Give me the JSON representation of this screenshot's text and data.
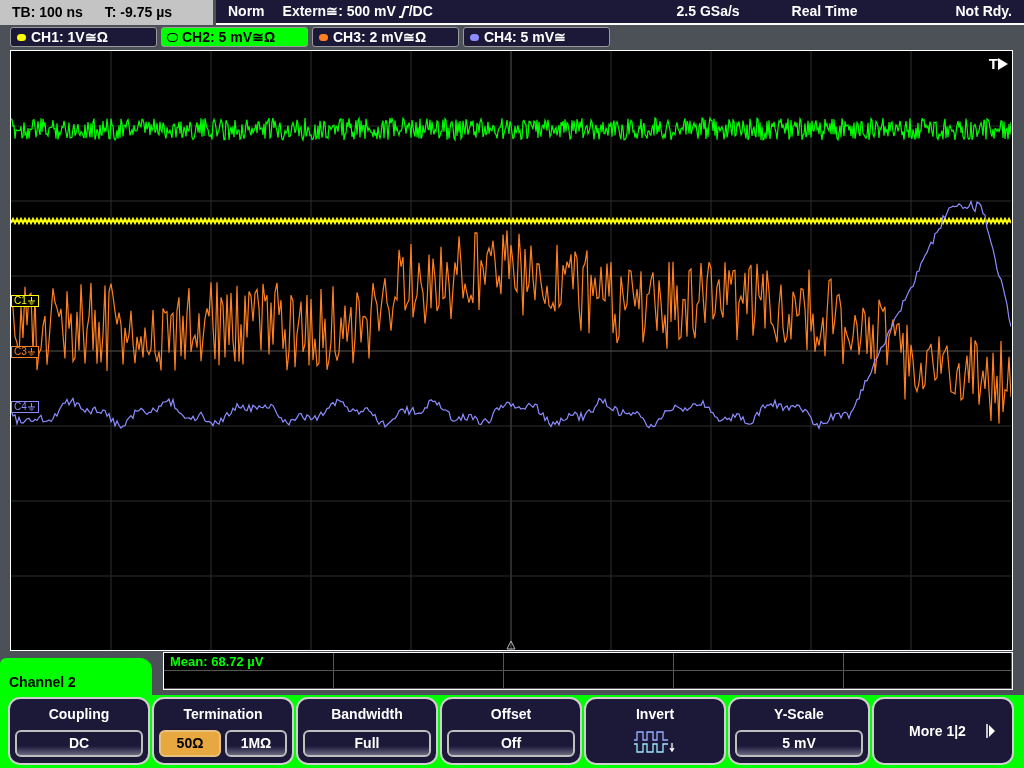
{
  "status_bar": {
    "timebase": "TB: 100 ns",
    "trigger_time": "T: -9.75 µs",
    "mode": "Norm",
    "trigger_source": "Extern≅: 500 mV",
    "trigger_coupling": "/DC",
    "sample_rate": "2.5 GSa/s",
    "acquisition": "Real Time",
    "state": "Not Rdy."
  },
  "channels": [
    {
      "label": "CH1: 1V≅Ω",
      "color": "#ffff00",
      "selected": false
    },
    {
      "label": "CH2: 5 mV≅Ω",
      "color": "#00ff00",
      "selected": true
    },
    {
      "label": "CH3: 2 mV≅Ω",
      "color": "#ff8020",
      "selected": false
    },
    {
      "label": "CH4: 5 mV≅",
      "color": "#8c8cff",
      "selected": false
    }
  ],
  "trace_markers": [
    {
      "label": "C1",
      "color": "#ffff00"
    },
    {
      "label": "C3",
      "color": "#ff8020"
    },
    {
      "label": "C4",
      "color": "#8c8cff"
    }
  ],
  "trigger_marker": "T",
  "measurement": "Mean: 68.72 µV",
  "menu": {
    "title": "Channel 2",
    "softkeys": [
      {
        "kind": "value",
        "label": "Coupling",
        "value": "DC"
      },
      {
        "kind": "choice",
        "label": "Termination",
        "options": [
          {
            "text": "50Ω",
            "selected": true
          },
          {
            "text": "1MΩ",
            "selected": false
          }
        ]
      },
      {
        "kind": "value",
        "label": "Bandwidth",
        "value": "Full"
      },
      {
        "kind": "value",
        "label": "Offset",
        "value": "Off"
      },
      {
        "kind": "icon",
        "label": "Invert"
      },
      {
        "kind": "value",
        "label": "Y-Scale",
        "value": "5 mV"
      },
      {
        "kind": "next",
        "label": "More 1|2"
      }
    ]
  }
}
